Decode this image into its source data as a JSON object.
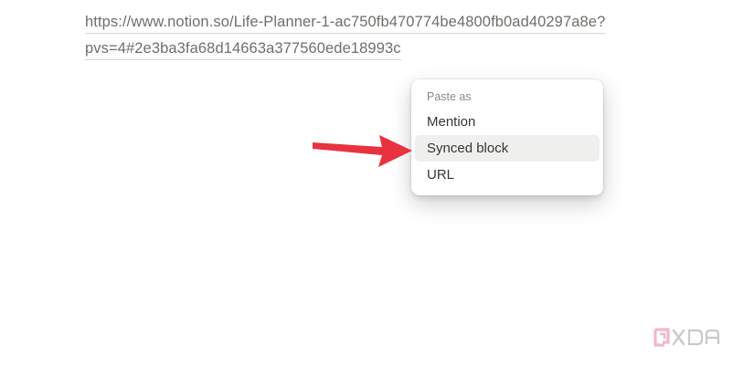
{
  "content": {
    "url_line1": "https://www.notion.so/Life-Planner-1-ac750fb470774be4800fb0ad40297a8e?",
    "url_line2": "pvs=4#2e3ba3fa68d14663a377560ede18993c"
  },
  "paste_menu": {
    "header": "Paste as",
    "items": [
      {
        "label": "Mention"
      },
      {
        "label": "Synced block",
        "selected": true
      },
      {
        "label": "URL"
      }
    ]
  },
  "annotation": {
    "arrow_color": "#e8323f",
    "arrow_icon": "red-arrow-pointing-right"
  },
  "watermark": {
    "logo_text": "XDA",
    "icon": "xda-logo-icon"
  }
}
